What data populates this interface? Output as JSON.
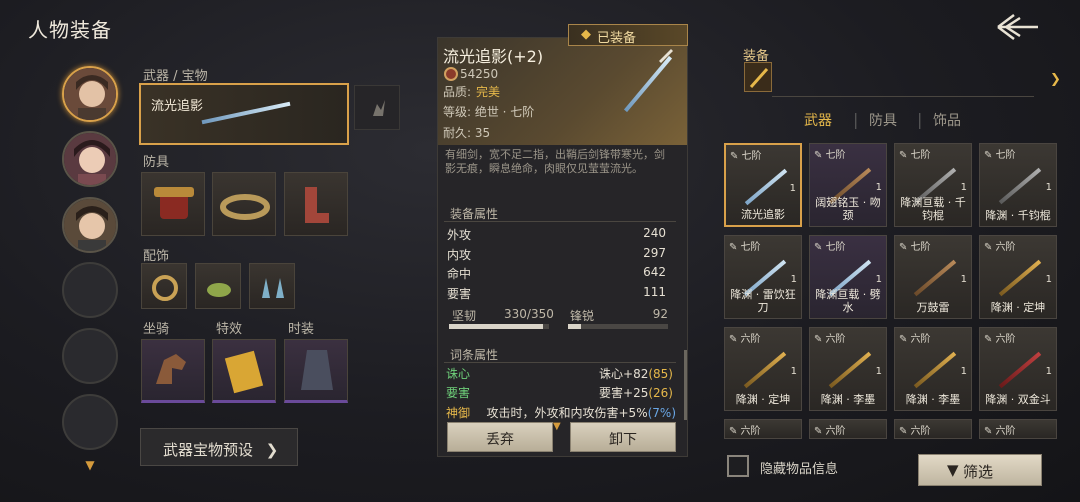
{
  "header": {
    "title": "人物装备"
  },
  "left": {
    "weapon_section": "武器 / 宝物",
    "weapon_name": "流光追影",
    "armor_section": "防具",
    "accessory_section": "配饰",
    "mount_section": "坐骑",
    "effect_section": "特效",
    "costume_section": "时装",
    "preset_button": "武器宝物预设"
  },
  "detail": {
    "equipped_badge": "已装备",
    "name": "流光追影(+2)",
    "price": "54250",
    "quality_label": "品质:",
    "quality_value": "完美",
    "grade": "等级: 绝世 · 七阶",
    "durability": "耐久: 35",
    "description": "有细剑，宽不足二指，出鞘后剑锋带寒光，剑影无痕，瞬息绝命，肉眼仅见莹莹流光。",
    "stats_title": "装备属性",
    "stats": [
      {
        "name": "外攻",
        "value": "240"
      },
      {
        "name": "内攻",
        "value": "297"
      },
      {
        "name": "命中",
        "value": "642"
      },
      {
        "name": "要害",
        "value": "111"
      }
    ],
    "toughness_label": "坚韧",
    "toughness_value": "330/350",
    "toughness_fill": 0.94,
    "sharp_label": "锋锐",
    "sharp_value": "92",
    "sharp_fill": 0.13,
    "affix_title": "词条属性",
    "affixes": [
      {
        "tag": "诛心",
        "main": "诛心+82",
        "extra": "(85)"
      },
      {
        "tag": "要害",
        "main": "要害+25",
        "extra": "(26)"
      },
      {
        "tag": "神御",
        "main": "攻击时，外攻和内攻伤害+5%",
        "extra": "(7%)"
      }
    ],
    "discard_button": "丢弃",
    "unequip_button": "卸下"
  },
  "right": {
    "equip_label": "装备",
    "tabs": [
      "武器",
      "防具",
      "饰品"
    ],
    "items": [
      {
        "tier": "七阶",
        "count": "1",
        "name": "流光追影",
        "sel": true
      },
      {
        "tier": "七阶",
        "count": "1",
        "name": "阔翅铭玉 · 吻颈"
      },
      {
        "tier": "七阶",
        "count": "1",
        "name": "降渊亘载 · 千钧棍"
      },
      {
        "tier": "七阶",
        "count": "1",
        "name": "降渊 · 千钧棍"
      },
      {
        "tier": "七阶",
        "count": "1",
        "name": "降渊 · 雷饮狂刀"
      },
      {
        "tier": "七阶",
        "count": "1",
        "name": "降渊亘载 · 劈水"
      },
      {
        "tier": "七阶",
        "count": "1",
        "name": "万鼓雷"
      },
      {
        "tier": "六阶",
        "count": "1",
        "name": "降渊 · 定坤"
      },
      {
        "tier": "六阶",
        "count": "1",
        "name": "降渊 · 定坤"
      },
      {
        "tier": "六阶",
        "count": "1",
        "name": "降渊 · 李墨"
      },
      {
        "tier": "六阶",
        "count": "1",
        "name": "降渊 · 李墨"
      },
      {
        "tier": "六阶",
        "count": "1",
        "name": "降渊 · 双金斗"
      },
      {
        "tier": "六阶",
        "count": "",
        "name": ""
      },
      {
        "tier": "六阶",
        "count": "",
        "name": ""
      },
      {
        "tier": "六阶",
        "count": "",
        "name": ""
      },
      {
        "tier": "六阶",
        "count": "",
        "name": ""
      }
    ],
    "hide_info_label": "隐藏物品信息",
    "filter_button": "筛选"
  }
}
